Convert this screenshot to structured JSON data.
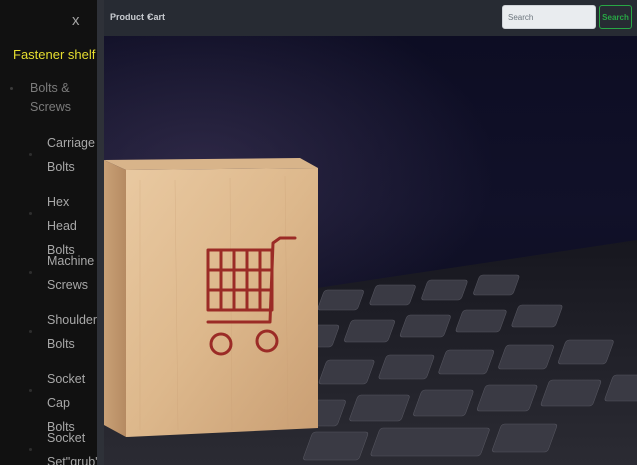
{
  "navbar": {
    "product_label": "Product",
    "cart_label": "Cart",
    "search_placeholder": "Search",
    "search_button_label": "Search"
  },
  "sidebar": {
    "close_label": "x",
    "brand": "Fastener shelf",
    "category": "Bolts & Screws",
    "items": [
      {
        "label": "Carriage Bolts"
      },
      {
        "label": "Hex Head Bolts"
      },
      {
        "label": "Machine Screws"
      },
      {
        "label": "Shoulder Bolts"
      },
      {
        "label": "Socket Cap Bolts"
      },
      {
        "label": "Socket Set\"grub\""
      }
    ]
  },
  "colors": {
    "brand_yellow": "#e6de2f",
    "navbar_bg": "#272b33",
    "sidebar_bg": "#111111",
    "search_green": "#28a745",
    "cart_red": "#9b2b26"
  },
  "hero": {
    "icon": "shopping-cart-icon"
  }
}
